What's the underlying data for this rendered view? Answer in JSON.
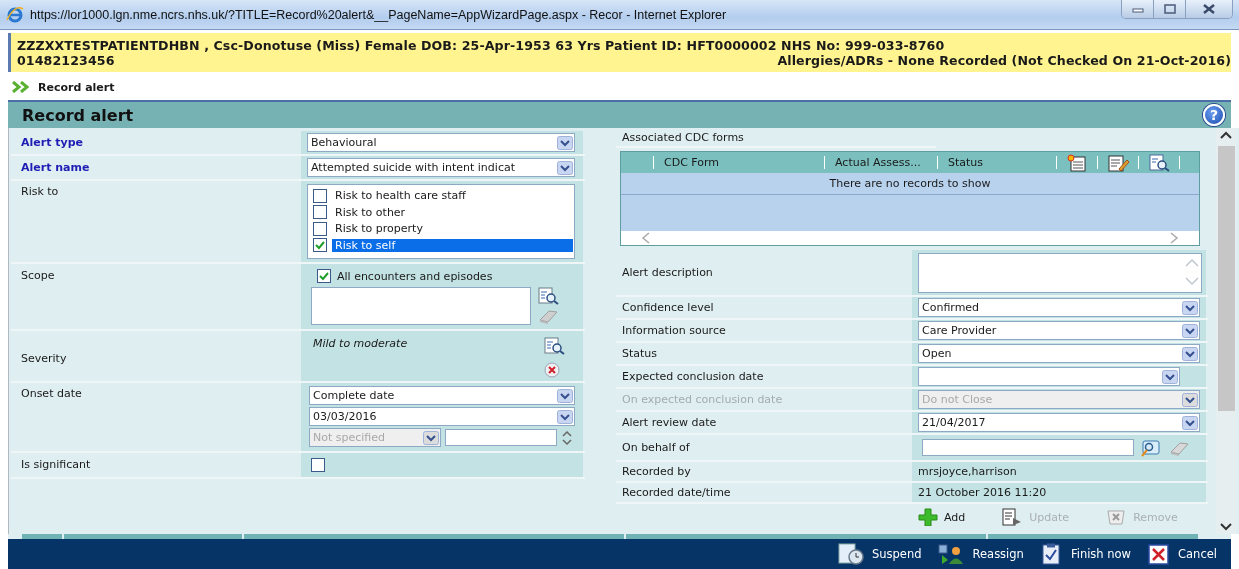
{
  "window": {
    "title": "https://lor1000.lgn.nme.ncrs.nhs.uk/?TITLE=Record%20alert&__PageName=AppWizardPage.aspx - Recor - Internet Explorer"
  },
  "patient_banner": {
    "line_1": "ZZZXXTESTPATIENTDHBN , Csc-Donotuse (Miss) Female DOB: 25-Apr-1953 63 Yrs Patient ID: HFT0000002 NHS No: 999-033-8760",
    "phone": "01482123456",
    "allergies": "Allergies/ADRs - None Recorded (Not Checked On 21-Oct-2016)"
  },
  "breadcrumb": "Record alert",
  "page_header": {
    "title": "Record alert",
    "help": "?"
  },
  "left_form": {
    "alert_type": {
      "label": "Alert type",
      "value": "Behavioural"
    },
    "alert_name": {
      "label": "Alert name",
      "value": "Attempted suicide with intent indicat"
    },
    "risk_to": {
      "label": "Risk to",
      "options": [
        {
          "label": "Risk to health care staff",
          "checked": false,
          "selected": false
        },
        {
          "label": "Risk to other",
          "checked": false,
          "selected": false
        },
        {
          "label": "Risk to property",
          "checked": false,
          "selected": false
        },
        {
          "label": "Risk to self",
          "checked": true,
          "selected": true
        }
      ]
    },
    "scope": {
      "label": "Scope",
      "option": {
        "label": "All encounters and episodes",
        "checked": true
      }
    },
    "severity": {
      "label": "Severity",
      "value": "Mild to moderate"
    },
    "onset_date": {
      "label": "Onset date",
      "precision": "Complete date",
      "date": "03/03/2016",
      "time_mode": "Not specified"
    },
    "is_significant": {
      "label": "Is significant",
      "checked": false
    }
  },
  "right_form": {
    "cdc_forms": {
      "label": "Associated CDC forms",
      "columns": [
        "CDC Form",
        "Actual Assess...",
        "Status"
      ],
      "empty_message": "There are no records to show"
    },
    "fields": [
      {
        "kind": "textarea",
        "label": "Alert description",
        "disabled": false
      },
      {
        "kind": "select",
        "label": "Confidence level",
        "value": "Confirmed",
        "disabled": false
      },
      {
        "kind": "select",
        "label": "Information source",
        "value": "Care Provider",
        "disabled": false
      },
      {
        "kind": "select",
        "label": "Status",
        "value": "Open",
        "disabled": false
      },
      {
        "kind": "date",
        "label": "Expected conclusion date",
        "disabled": false
      },
      {
        "kind": "select",
        "label": "On expected conclusion date",
        "value": "Do not Close",
        "disabled": true
      },
      {
        "kind": "select",
        "label": "Alert review date",
        "value": "21/04/2017",
        "disabled": false
      },
      {
        "kind": "lookup",
        "label": "On behalf of",
        "disabled": false
      },
      {
        "kind": "text",
        "label": "Recorded by",
        "value": "mrsjoyce,harrison",
        "disabled": false
      },
      {
        "kind": "text",
        "label": "Recorded date/time",
        "value": "21 October 2016 11:20",
        "disabled": false
      }
    ],
    "actions": [
      {
        "kind": "add",
        "label": "Add",
        "disabled": false
      },
      {
        "kind": "update",
        "label": "Update",
        "disabled": true
      },
      {
        "kind": "remove",
        "label": "Remove",
        "disabled": true
      }
    ]
  },
  "footer_actions": [
    {
      "kind": "suspend",
      "label": "Suspend"
    },
    {
      "kind": "reassign",
      "label": "Reassign"
    },
    {
      "kind": "finish",
      "label": "Finish now"
    },
    {
      "kind": "cancel",
      "label": "Cancel"
    }
  ]
}
